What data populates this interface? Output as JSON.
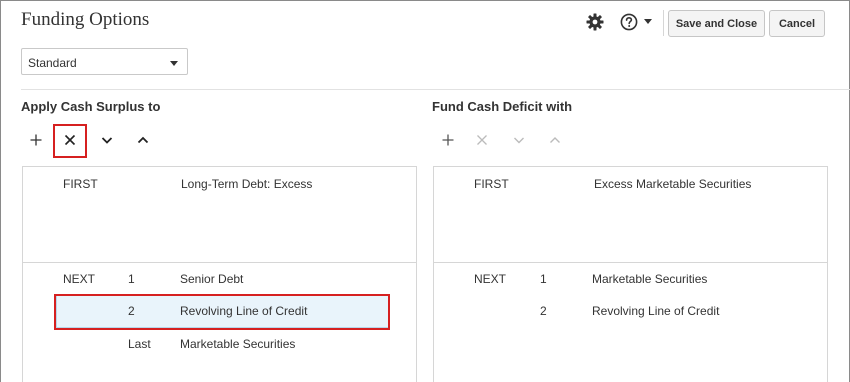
{
  "header": {
    "title": "Funding Options",
    "save_close_label": "Save and Close",
    "cancel_label": "Cancel",
    "icons": [
      "gear-icon",
      "help-icon",
      "chevron-down-icon"
    ]
  },
  "scenario_select": {
    "value": "Standard"
  },
  "surplus": {
    "title": "Apply Cash Surplus to",
    "first": {
      "label": "FIRST",
      "item": "Long-Term Debt: Excess"
    },
    "next_label": "NEXT",
    "rows": [
      {
        "order": "1",
        "item": "Senior Debt"
      },
      {
        "order": "2",
        "item": "Revolving Line of Credit"
      },
      {
        "order": "Last",
        "item": "Marketable Securities"
      }
    ]
  },
  "deficit": {
    "title": "Fund Cash Deficit with",
    "first": {
      "label": "FIRST",
      "item": "Excess Marketable Securities"
    },
    "next_label": "NEXT",
    "rows": [
      {
        "order": "1",
        "item": "Marketable Securities"
      },
      {
        "order": "2",
        "item": "Revolving Line of Credit"
      }
    ]
  },
  "colors": {
    "accent_red": "#d62020",
    "selected_row": "#e9f4fb",
    "disabled_icon": "#b5b5b5"
  }
}
